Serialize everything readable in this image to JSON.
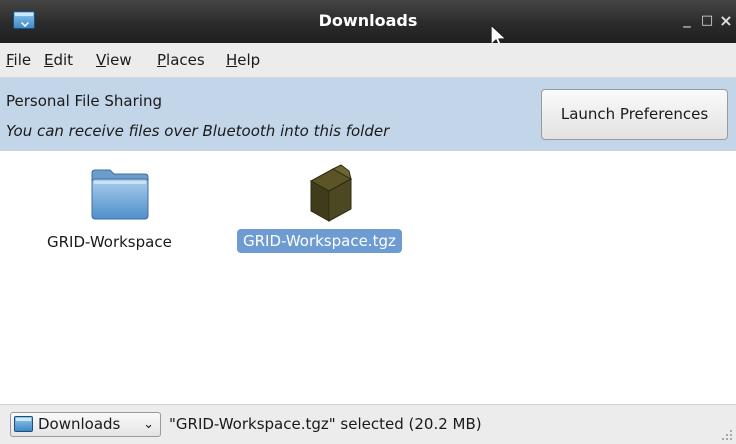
{
  "window": {
    "title": "Downloads",
    "icon": "window-app-icon"
  },
  "window_controls": {
    "minimize": "_",
    "maximize": "□",
    "close": "×"
  },
  "menubar": {
    "items": [
      {
        "label": "File",
        "mnemonic": "F",
        "rest": "ile"
      },
      {
        "label": "Edit",
        "mnemonic": "E",
        "rest": "dit"
      },
      {
        "label": "View",
        "mnemonic": "V",
        "rest": "iew"
      },
      {
        "label": "Places",
        "mnemonic": "P",
        "rest": "laces"
      },
      {
        "label": "Help",
        "mnemonic": "H",
        "rest": "elp"
      }
    ]
  },
  "infobar": {
    "title": "Personal File Sharing",
    "subtitle": "You can receive files over Bluetooth into this folder",
    "button_label": "Launch Preferences",
    "background": "#c3d6e9"
  },
  "files": [
    {
      "name": "GRID-Workspace",
      "type": "folder",
      "icon": "folder-icon",
      "selected": false
    },
    {
      "name": "GRID-Workspace.tgz",
      "type": "archive",
      "icon": "package-icon",
      "selected": true
    }
  ],
  "statusbar": {
    "location": "Downloads",
    "location_icon": "folder-location-icon",
    "chevron": "⌄",
    "status": "\"GRID-Workspace.tgz\" selected (20.2 MB)"
  },
  "colors": {
    "selection": "#6e9bd1",
    "titlebar": "#2b2b2b"
  }
}
